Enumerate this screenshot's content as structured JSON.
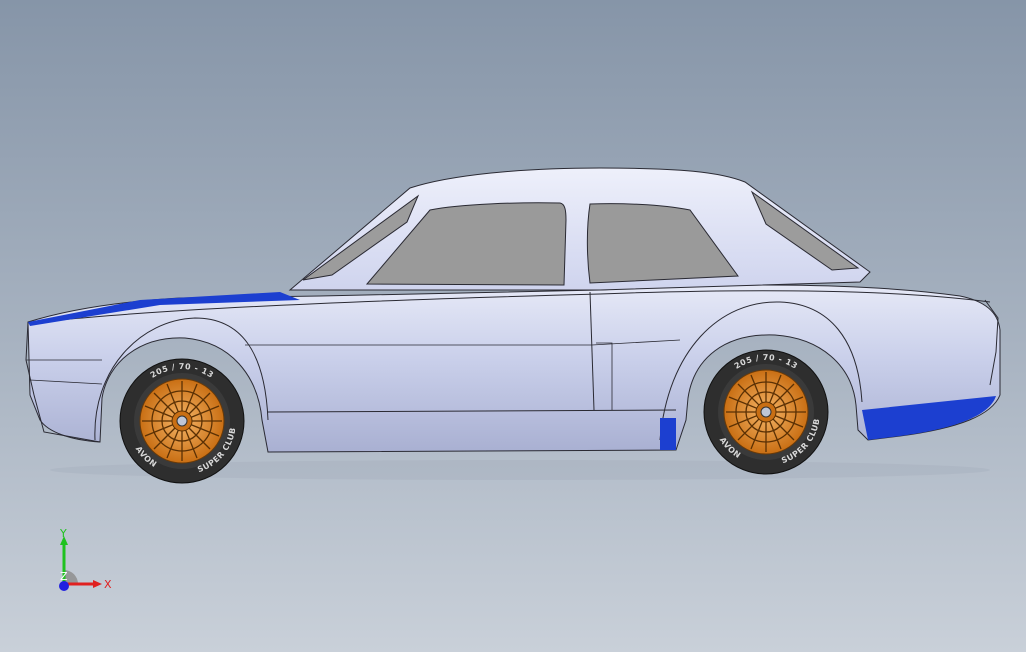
{
  "viewport": {
    "background_top": "#8695a8",
    "background_bottom": "#c9d0d9"
  },
  "model": {
    "body_color": "#c2c8e6",
    "window_color": "#9a9a9a",
    "stripe_color": "#1c3fd0",
    "wheel_color": "#e08a2a",
    "tire_color": "#2e2e2e",
    "front_tire": {
      "size_text": "205 / 70 - 13",
      "brand_text": "AVON",
      "model_text": "SUPER CLUB"
    },
    "rear_tire": {
      "size_text": "205 / 70 - 13",
      "brand_text": "AVON",
      "model_text": "SUPER CLUB"
    }
  },
  "triad": {
    "y_label": "Y",
    "x_label": "X",
    "z_label": "Z",
    "y_color": "#1fc21f",
    "x_color": "#e02020",
    "z_color": "#2020e0"
  }
}
